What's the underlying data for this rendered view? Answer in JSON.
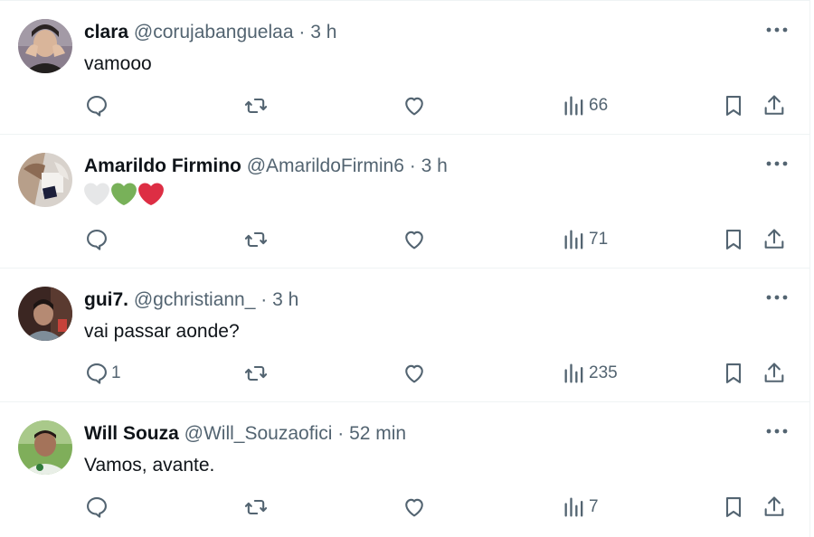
{
  "tweets": [
    {
      "name": "clara",
      "handle": "@corujabanguelaa",
      "separator": "·",
      "time": "3 h",
      "text": "vamooo",
      "reply_count": "",
      "views": "66"
    },
    {
      "name": "Amarildo Firmino",
      "handle": "@AmarildoFirmin6",
      "separator": "·",
      "time": "3 h",
      "text": "",
      "hearts": [
        "white-heart",
        "green-heart",
        "red-heart"
      ],
      "reply_count": "",
      "views": "71"
    },
    {
      "name": "gui7.",
      "handle": "@gchristiann_",
      "separator": "·",
      "time": "3 h",
      "text": "vai passar aonde?",
      "reply_count": "1",
      "views": "235"
    },
    {
      "name": "Will Souza",
      "handle": "@Will_Souzaofici",
      "separator": "·",
      "time": "52 min",
      "text": "Vamos, avante.",
      "reply_count": "",
      "views": "7"
    }
  ],
  "colors": {
    "text_primary": "#0f1419",
    "text_secondary": "#536471",
    "border": "#eff3f4",
    "heart_green": "#78b159",
    "heart_red": "#dd2e44",
    "heart_white": "#e6e7e8"
  },
  "icons": [
    "reply-icon",
    "retweet-icon",
    "like-icon",
    "views-icon",
    "bookmark-icon",
    "share-icon",
    "more-icon"
  ]
}
